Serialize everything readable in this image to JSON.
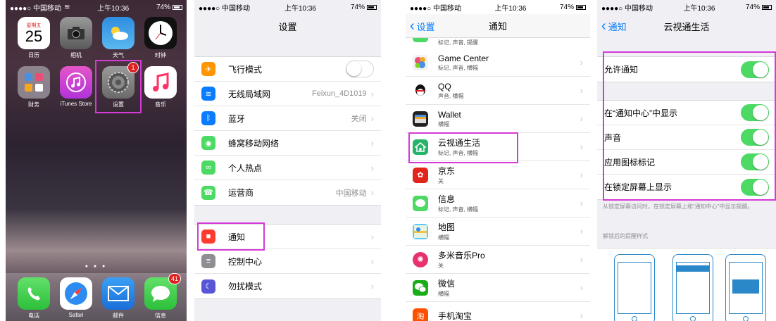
{
  "status": {
    "carrier": "●●●●○ 中国移动",
    "time": "上午10:36",
    "battery": "74%"
  },
  "home": {
    "calendar_weekday": "星期五",
    "calendar_day": "25",
    "apps": [
      {
        "label": "日历",
        "icon": "calendar-icon"
      },
      {
        "label": "相机",
        "icon": "camera-icon"
      },
      {
        "label": "天气",
        "icon": "weather-icon"
      },
      {
        "label": "时钟",
        "icon": "clock-icon"
      },
      {
        "label": "财务",
        "icon": "folder-icon"
      },
      {
        "label": "iTunes Store",
        "icon": "itunes-icon"
      },
      {
        "label": "设置",
        "icon": "settings-icon",
        "badge": "1"
      },
      {
        "label": "音乐",
        "icon": "music-icon"
      }
    ],
    "dock": [
      {
        "label": "电话",
        "icon": "phone-icon"
      },
      {
        "label": "Safari",
        "icon": "safari-icon"
      },
      {
        "label": "邮件",
        "icon": "mail-icon"
      },
      {
        "label": "信息",
        "icon": "messages-icon",
        "badge": "41"
      }
    ]
  },
  "settings": {
    "title": "设置",
    "group1": [
      {
        "label": "飞行模式",
        "icon": "airplane-icon",
        "color": "#ff9500"
      },
      {
        "label": "无线局域网",
        "detail": "Feixun_4D1019",
        "icon": "wifi-icon",
        "color": "#0a7cff"
      },
      {
        "label": "蓝牙",
        "detail": "关闭",
        "icon": "bluetooth-icon",
        "color": "#0a7cff"
      },
      {
        "label": "蜂窝移动网络",
        "icon": "cellular-icon",
        "color": "#4cd964"
      },
      {
        "label": "个人热点",
        "icon": "hotspot-icon",
        "color": "#4cd964"
      },
      {
        "label": "运营商",
        "detail": "中国移动",
        "icon": "carrier-icon",
        "color": "#4cd964"
      }
    ],
    "group2": [
      {
        "label": "通知",
        "icon": "notification-icon",
        "color": "#ff3b30"
      },
      {
        "label": "控制中心",
        "icon": "control-center-icon",
        "color": "#8e8e93"
      },
      {
        "label": "勿扰模式",
        "icon": "moon-icon",
        "color": "#5856d6"
      }
    ]
  },
  "notifications": {
    "back": "设置",
    "title": "通知",
    "top_partial_sub": "标记, 声音, 提醒",
    "apps": [
      {
        "name": "Game Center",
        "sub": "标记, 声音, 横幅",
        "icon": "game-center-icon",
        "color": "#f2f2f2"
      },
      {
        "name": "QQ",
        "sub": "声音, 横幅",
        "icon": "qq-icon",
        "color": "#ffffff"
      },
      {
        "name": "Wallet",
        "sub": "横幅",
        "icon": "wallet-icon",
        "color": "#222222"
      },
      {
        "name": "云视通生活",
        "sub": "标记, 声音, 横幅",
        "icon": "cloud-home-icon",
        "color": "#27b36a"
      },
      {
        "name": "京东",
        "sub": "关",
        "icon": "jd-icon",
        "color": "#e1251b"
      },
      {
        "name": "信息",
        "sub": "标记, 声音, 横幅",
        "icon": "messages-icon",
        "color": "#4cd964"
      },
      {
        "name": "地图",
        "sub": "横幅",
        "icon": "maps-icon",
        "color": "#5ac8fa"
      },
      {
        "name": "多米音乐Pro",
        "sub": "关",
        "icon": "duomi-icon",
        "color": "#e8326e"
      },
      {
        "name": "微信",
        "sub": "横幅",
        "icon": "wechat-icon",
        "color": "#1aad19"
      },
      {
        "name": "手机淘宝",
        "sub": "",
        "icon": "taobao-icon",
        "color": "#ff5000"
      }
    ]
  },
  "app_detail": {
    "back": "通知",
    "title": "云视通生活",
    "allow_label": "允许通知",
    "rows": [
      {
        "label": "在“通知中心”中显示"
      },
      {
        "label": "声音"
      },
      {
        "label": "应用图标标记"
      },
      {
        "label": "在锁定屏幕上显示"
      }
    ],
    "footnote": "从锁定屏幕访问时，在锁定屏幕上和“通知中心”中显示提醒。",
    "alert_style_label": "解锁后的提醒样式"
  },
  "colors": {
    "highlight": "#d63ad6",
    "ios_blue": "#0a7cff",
    "toggle_on": "#4cd964"
  }
}
